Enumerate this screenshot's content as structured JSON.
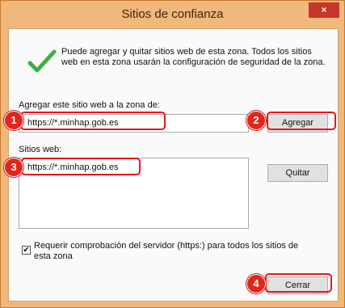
{
  "window": {
    "title": "Sitios de confianza",
    "close_label": "×"
  },
  "intro": {
    "icon": "checkmark-icon",
    "text": "Puede agregar y quitar sitios web de esta zona. Todos los sitios web en esta zona usarán la configuración de seguridad de la zona."
  },
  "add_zone": {
    "label": "Agregar este sitio web a la zona de:",
    "input_value": "https://*.minhap.gob.es",
    "button_label": "Agregar"
  },
  "websites": {
    "label": "Sitios web:",
    "items": [
      "https://*.minhap.gob.es"
    ],
    "remove_label": "Quitar"
  },
  "require_https": {
    "checked": true,
    "check_mark": "✔",
    "label": "Requerir comprobación del servidor (https:) para todos los sitios de esta zona"
  },
  "close_button": {
    "label": "Cerrar"
  },
  "callouts": [
    "1",
    "2",
    "3",
    "4"
  ],
  "colors": {
    "titlebar": "#f0b87a",
    "close": "#c7352c",
    "callout": "#e2261c",
    "highlight": "#e3161e",
    "check": "#3cb043"
  }
}
